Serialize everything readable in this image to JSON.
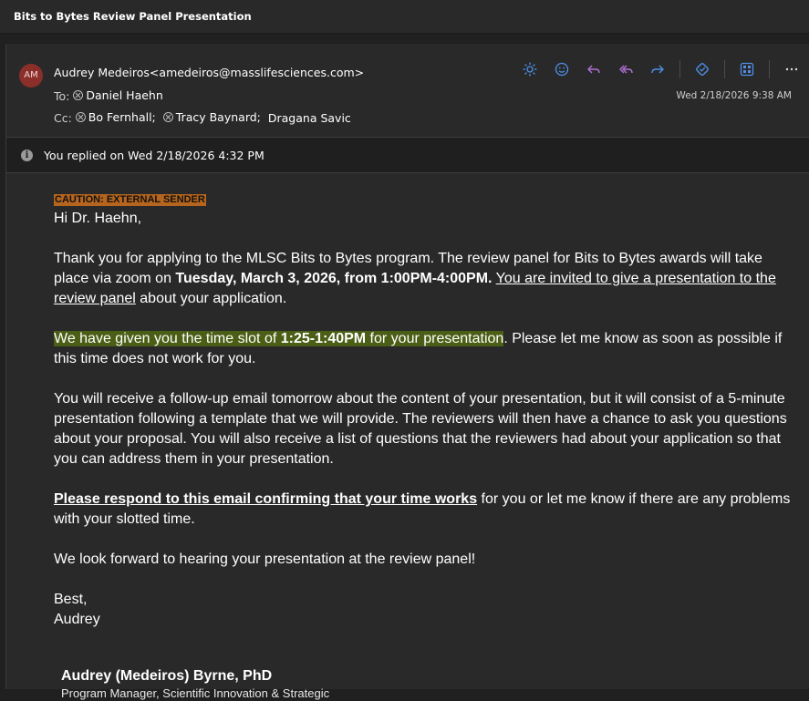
{
  "window": {
    "title": "Bits to Bytes Review Panel Presentation"
  },
  "header": {
    "avatar_initials": "AM",
    "from": "Audrey Medeiros<amedeiros@masslifesciences.com>",
    "to_label": "To:",
    "to": [
      "Daniel Haehn"
    ],
    "cc_label": "Cc:",
    "cc": [
      "Bo Fernhall;",
      "Tracy Baynard;",
      "Dragana Savic"
    ],
    "date": "Wed 2/18/2026 9:38 AM",
    "toolbar_icons": [
      "sun-icon",
      "emoji-icon",
      "reply-icon",
      "reply-all-icon",
      "forward-icon",
      "tag-icon",
      "apps-icon",
      "more-icon"
    ]
  },
  "banner": {
    "text": "You replied on Wed 2/18/2026 4:32 PM"
  },
  "message": {
    "caution": "CAUTION: EXTERNAL SENDER",
    "greeting": "Hi Dr. Haehn,",
    "p1_a": "Thank you for applying to the MLSC Bits to Bytes program. The review panel for Bits to Bytes awards will take place via zoom on ",
    "p1_b": "Tuesday, March 3, 2026, from 1:00PM-4:00PM.",
    "p1_c": " ",
    "p1_d": "You are invited to give a presentation to the review panel",
    "p1_e": " about your application.",
    "p2_a": "We have given you the time slot of ",
    "p2_b": "1:25-1:40PM",
    "p2_c": " for your presentation",
    "p2_d": ". Please let me know as soon as possible if this time does not work for you.",
    "p3": "You will receive a follow-up email tomorrow about the content of your presentation, but it will consist of a 5-minute presentation following a template that we will provide. The reviewers will then have a chance to ask you questions about your proposal. You will also receive a list of questions that the reviewers had about your application so that you can address them in your presentation.",
    "p4_a": "Please respond to this email confirming that your time works",
    "p4_b": " for you or let me know if there are any problems with your slotted time.",
    "p5": "We look forward to hearing your presentation at the review panel!",
    "closing": "Best,",
    "closing_name": "Audrey",
    "sig_name": "Audrey (Medeiros) Byrne, PhD",
    "sig_title": "Program Manager, Scientific Innovation & Strategic"
  },
  "colors": {
    "caution_bg": "#b5651d",
    "highlight_green": "#4b5e15",
    "avatar_bg": "#8b2f2b",
    "icon_blue": "#4f8fe6",
    "icon_purple": "#b070d8"
  }
}
